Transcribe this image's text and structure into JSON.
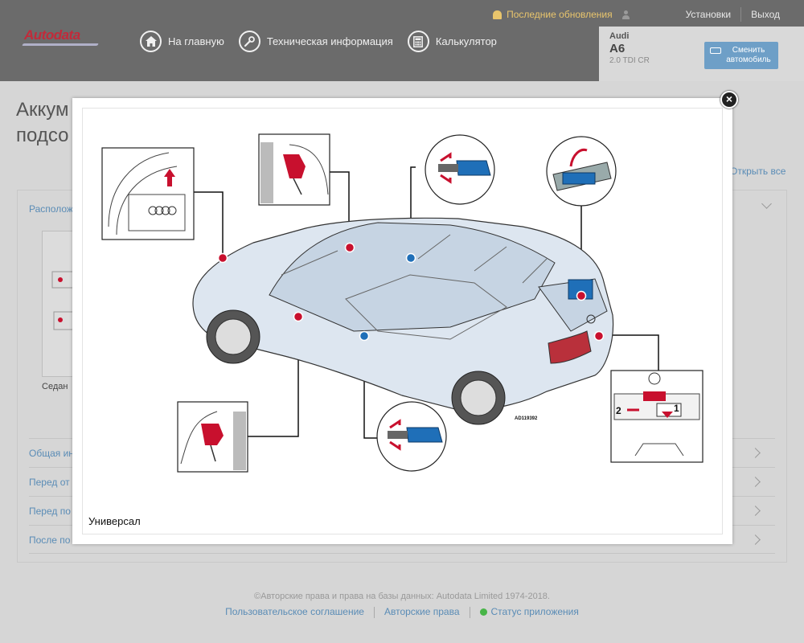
{
  "header": {
    "logo": "Autodata",
    "nav": [
      {
        "label": "На главную",
        "icon": "home-icon"
      },
      {
        "label": "Техническая информация",
        "icon": "wrench-icon"
      },
      {
        "label": "Калькулятор",
        "icon": "calculator-icon"
      }
    ],
    "updates": "Последние обновления",
    "settings": "Установки",
    "logout": "Выход"
  },
  "vehicle": {
    "make": "Audi",
    "model": "A6",
    "engine": "2.0 TDI CR",
    "change_button": "Сменить автомобиль"
  },
  "page": {
    "title_line1": "Аккум",
    "title_line2": "подсо",
    "open_all": "Открыть все",
    "first_section": "Располож",
    "thumb_label": "Седан",
    "sections": [
      "Общая ин",
      "Перед от",
      "Перед по",
      "После по"
    ]
  },
  "modal": {
    "caption": "Универсал",
    "image_code": "AD119392",
    "callout_labels": [
      "2",
      "1"
    ]
  },
  "footer": {
    "copyright": "©Авторские права и права на базы данных: Autodata Limited 1974-2018.",
    "links": [
      "Пользовательское соглашение",
      "Авторские права",
      "Статус приложения"
    ]
  },
  "colors": {
    "accent": "#5a8cb6",
    "header": "#6b6b6b",
    "marker_red": "#c8102e",
    "marker_blue": "#1f6fb8",
    "status": "#48b548"
  }
}
